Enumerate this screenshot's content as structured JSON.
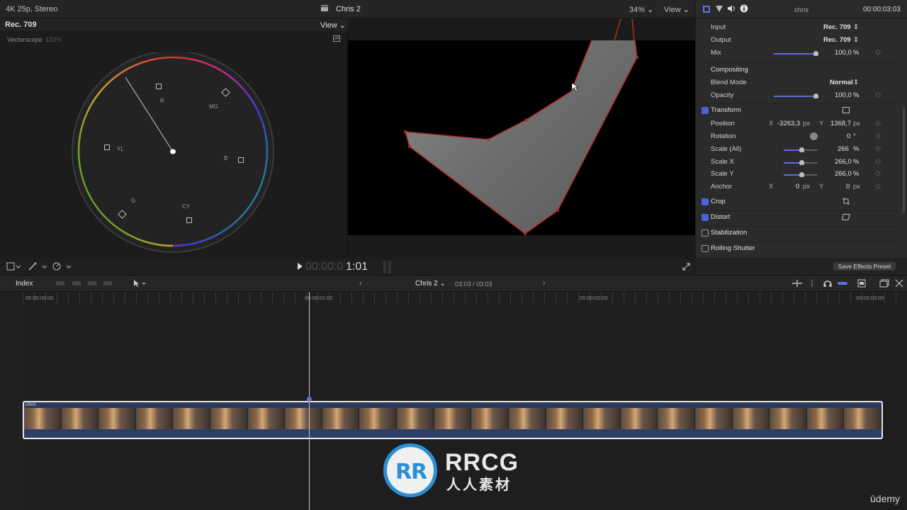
{
  "topbar": {
    "format": "4K 25p, Stereo",
    "project": "Chris 2",
    "zoom": "34%",
    "view": "View"
  },
  "inspector_top": {
    "clip_name": "chris",
    "duration": "00:00:03:03"
  },
  "scope": {
    "colorspace": "Rec. 709",
    "view": "View",
    "title": "Vectorscope",
    "zoom": "133%",
    "labels": [
      "R",
      "MG",
      "B",
      "CY",
      "G",
      "YL"
    ]
  },
  "transport": {
    "timecode_dim": "00:00:0",
    "timecode_bright": "1:01"
  },
  "inspector": {
    "input_label": "Input",
    "input_value": "Rec. 709",
    "output_label": "Output",
    "output_value": "Rec. 709",
    "mix_label": "Mix",
    "mix_value": "100,0",
    "mix_unit": "%",
    "compositing_label": "Compositing",
    "blend_label": "Blend Mode",
    "blend_value": "Normal",
    "opacity_label": "Opacity",
    "opacity_value": "100,0",
    "opacity_unit": "%",
    "transform_label": "Transform",
    "position_label": "Position",
    "pos_x_axis": "X",
    "pos_x": "-3263,3",
    "pos_x_unit": "px",
    "pos_y_axis": "Y",
    "pos_y": "1368,7",
    "pos_y_unit": "px",
    "rotation_label": "Rotation",
    "rotation_value": "0",
    "rotation_unit": "°",
    "scale_all_label": "Scale (All)",
    "scale_all_value": "266",
    "scale_all_unit": "%",
    "scale_x_label": "Scale X",
    "scale_x_value": "266,0",
    "scale_x_unit": "%",
    "scale_y_label": "Scale Y",
    "scale_y_value": "266,0",
    "scale_y_unit": "%",
    "anchor_label": "Anchor",
    "anchor_x_axis": "X",
    "anchor_x": "0",
    "anchor_x_unit": "px",
    "anchor_y_axis": "Y",
    "anchor_y": "0",
    "anchor_y_unit": "px",
    "crop_label": "Crop",
    "distort_label": "Distort",
    "stabilization_label": "Stabilization",
    "rolling_label": "Rolling Shutter",
    "save_preset": "Save Effects Preset"
  },
  "timeline": {
    "index": "Index",
    "project": "Chris 2",
    "position": "03:03 / 03:03",
    "ruler": [
      "00:00:00:00",
      "00:00:01:00",
      "00:00:02:00",
      "00:00:03:00"
    ],
    "clip_name": "chris"
  },
  "watermark": {
    "brand": "RRCG",
    "sub": "人人素材",
    "site": "ūdemy"
  }
}
